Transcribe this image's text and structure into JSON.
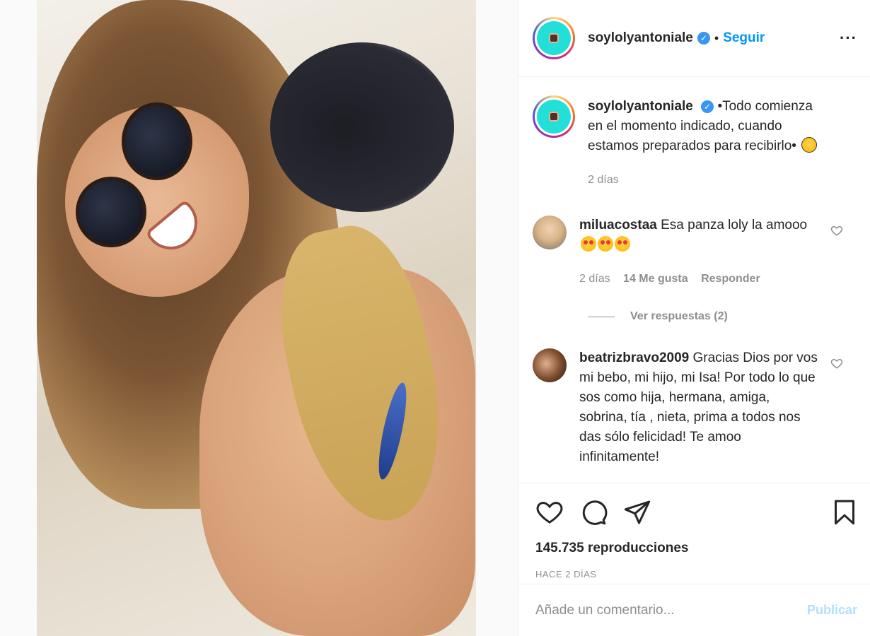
{
  "post": {
    "username": "soylolyantoniale",
    "verified_icon": "verified-badge-icon",
    "separator": "•",
    "follow_label": "Seguir",
    "more_label": "···"
  },
  "caption": {
    "username": "soylolyantoniale",
    "text": "•Todo comienza en el momento indicado, cuando estamos preparados para recibirlo•",
    "emoji": "smiling-face-icon",
    "time": "2 días"
  },
  "comments": [
    {
      "username": "miluacostaa",
      "text": "Esa panza loly la amooo",
      "emoji_count": 3,
      "time": "2 días",
      "likes": "14 Me gusta",
      "reply_label": "Responder",
      "view_replies": "Ver respuestas (2)"
    },
    {
      "username": "beatrizbravo2009",
      "text": "Gracias Dios por vos mi bebo, mi hijo, mi Isa! Por todo lo que sos como hija, hermana, amiga, sobrina, tía , nieta, prima a todos nos das sólo felicidad! Te amoo infinitamente!"
    }
  ],
  "stats": {
    "views": "145.735 reproducciones",
    "ago": "HACE 2 DÍAS"
  },
  "add_comment": {
    "placeholder": "Añade un comentario...",
    "publish_label": "Publicar"
  },
  "colors": {
    "accent": "#0095f6",
    "verified": "#3897f0",
    "muted": "#8e8e8e",
    "publish_disabled": "#b2dffc"
  }
}
